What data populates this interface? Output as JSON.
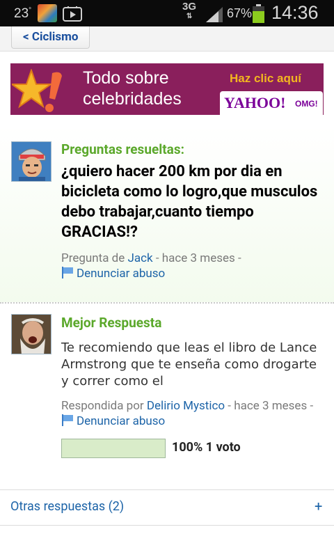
{
  "status_bar": {
    "temperature": "23",
    "degree": "°",
    "network": "3G",
    "network_arrows": "⇅",
    "battery_percent": "67%",
    "time": "14:36",
    "icons": [
      "weather-icon",
      "play-store-icon",
      "signal-icon",
      "battery-icon"
    ]
  },
  "nav": {
    "back_label": "< Ciclismo"
  },
  "ad": {
    "headline_line1": "Todo sobre",
    "headline_line2": "celebridades",
    "cta": "Haz clic aquí",
    "brand": "YAHOO!",
    "brand_suffix": "OMG!"
  },
  "question": {
    "label": "Preguntas resueltas:",
    "title": "¿quiero hacer 200 km por dia en bicicleta como lo logro,que musculos debo trabajar,cuanto tiempo GRACIAS!?",
    "asked_by_prefix": "Pregunta de",
    "author": "Jack",
    "time": " - hace 3 meses -",
    "report": "Denunciar abuso"
  },
  "best_answer": {
    "label": "Mejor Respuesta",
    "body": "Te recomiendo que leas el libro de Lance Armstrong que te enseña como drogarte y correr como el",
    "answered_by_prefix": "Respondida por",
    "author": "Delirio Mystico",
    "time": " - hace 3 meses -",
    "report": "Denunciar abuso",
    "vote_percent": 1.0,
    "vote_text": "100% 1 voto"
  },
  "other_answers": {
    "label": "Otras respuestas (2)",
    "expand": "+"
  },
  "colors": {
    "accent_green": "#5ba82b",
    "link_blue": "#1d64a8",
    "ad_bg": "#8a1f5c"
  }
}
